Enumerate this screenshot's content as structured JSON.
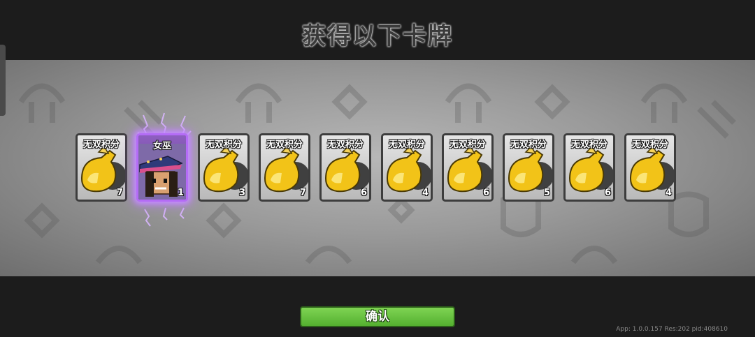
{
  "title": "获得以下卡牌",
  "cards": [
    {
      "name": "无双积分",
      "count": "7",
      "type": "points-bag"
    },
    {
      "name": "女巫",
      "count": "1",
      "type": "witch"
    },
    {
      "name": "无双积分",
      "count": "3",
      "type": "points-bag"
    },
    {
      "name": "无双积分",
      "count": "7",
      "type": "points-bag"
    },
    {
      "name": "无双积分",
      "count": "6",
      "type": "points-bag"
    },
    {
      "name": "无双积分",
      "count": "4",
      "type": "points-bag"
    },
    {
      "name": "无双积分",
      "count": "6",
      "type": "points-bag"
    },
    {
      "name": "无双积分",
      "count": "5",
      "type": "points-bag"
    },
    {
      "name": "无双积分",
      "count": "6",
      "type": "points-bag"
    },
    {
      "name": "无双积分",
      "count": "4",
      "type": "points-bag"
    }
  ],
  "confirm_label": "确认",
  "version": "App: 1.0.0.157 Res:202 pid:408610",
  "colors": {
    "confirm": "#6cc444",
    "special_glow": "#c58cff",
    "card_border": "#3d3d3d"
  }
}
